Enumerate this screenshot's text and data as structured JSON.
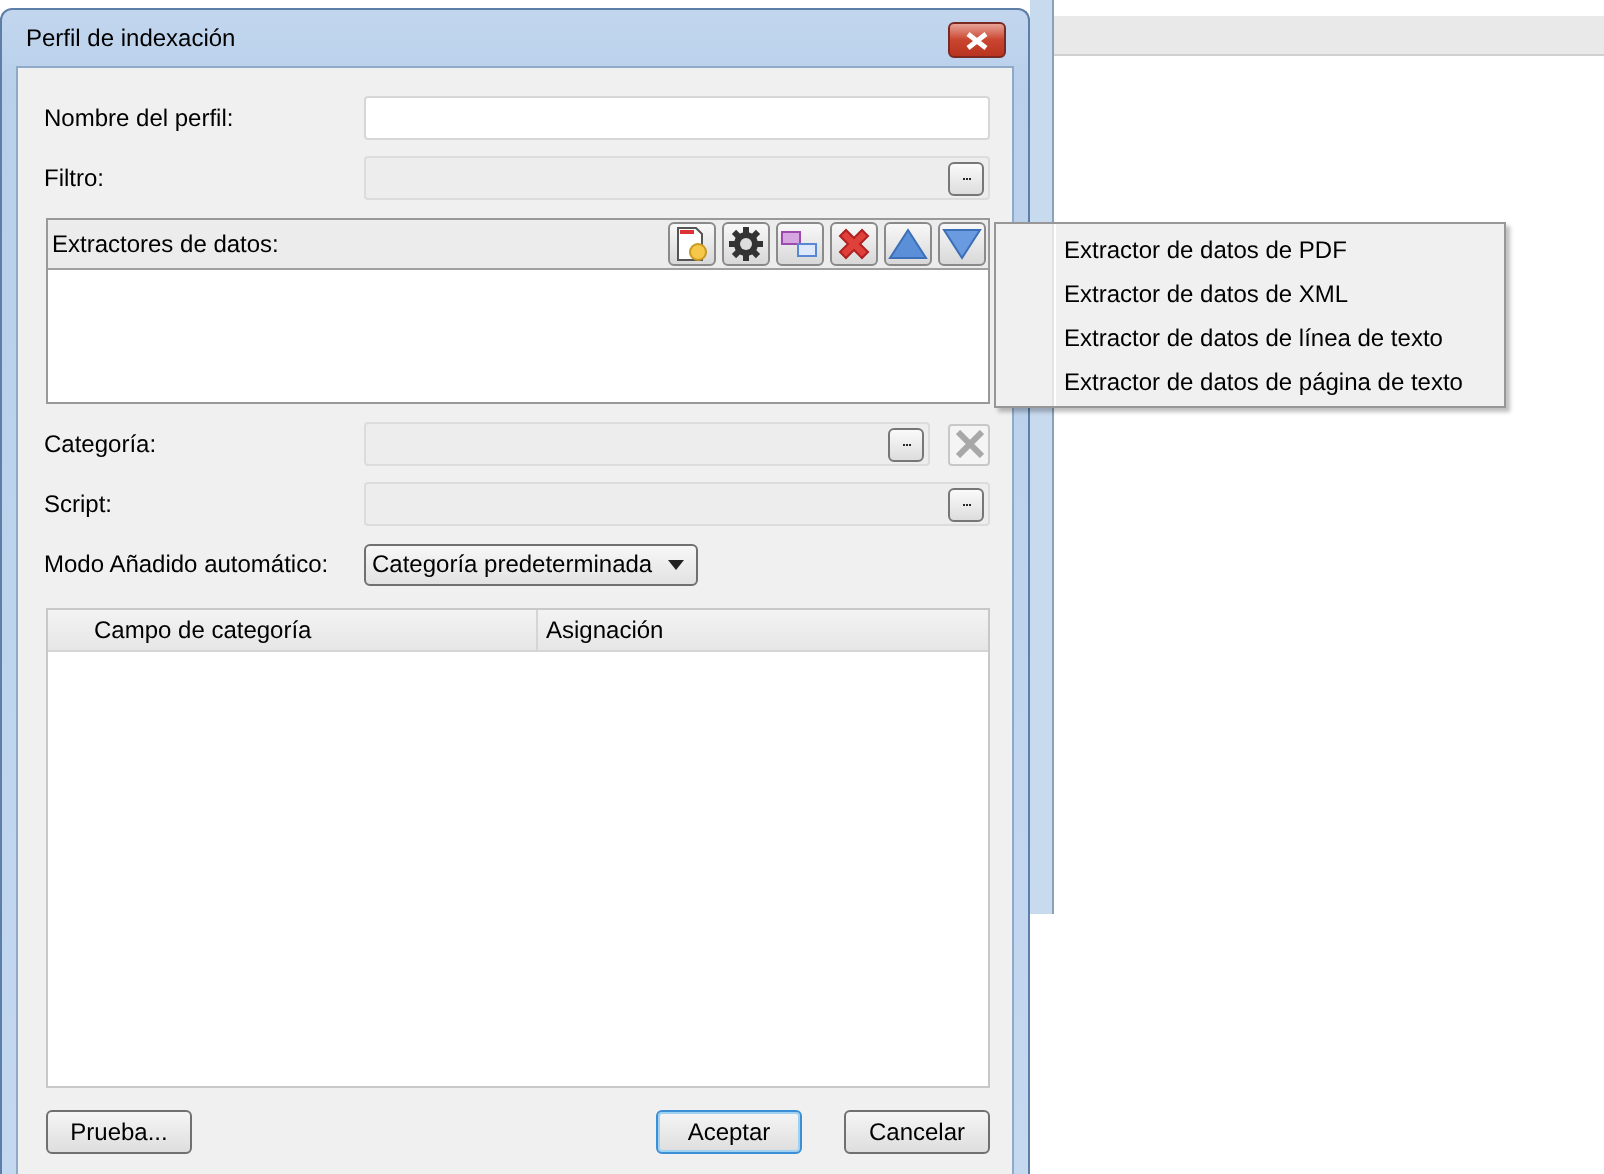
{
  "dialog": {
    "title": "Perfil de indexación"
  },
  "fields": [
    {
      "label": "Nombre del perfil:",
      "kind": "text",
      "disabled": false
    },
    {
      "label": "Filtro:",
      "kind": "browse",
      "button": "...",
      "disabled": true
    }
  ],
  "extractors": {
    "label": "Extractores de datos:",
    "toolbar": [
      {
        "kind": "new"
      },
      {
        "kind": "settings"
      },
      {
        "kind": "link"
      },
      {
        "kind": "delete"
      },
      {
        "kind": "up"
      },
      {
        "kind": "down"
      }
    ]
  },
  "fields_2": [
    {
      "label": "Categoría:",
      "kind": "browse_clear",
      "button": "...",
      "disabled": true
    },
    {
      "label": "Script:",
      "kind": "browse",
      "button": "...",
      "disabled": true
    },
    {
      "label": "Modo Añadido automático:",
      "kind": "dropdown",
      "value": "Categoría predeterminada",
      "disabled": false
    }
  ],
  "table": {
    "columns": [
      "Campo de categoría",
      "Asignación"
    ]
  },
  "buttons": [
    {
      "label": "Prueba...",
      "default": false
    },
    {
      "label": "Aceptar",
      "default": true
    },
    {
      "label": "Cancelar",
      "default": false
    }
  ],
  "menu": {
    "items": [
      "Extractor de datos de PDF",
      "Extractor de datos de XML",
      "Extractor de datos de línea de texto",
      "Extractor de datos de página de texto"
    ]
  }
}
